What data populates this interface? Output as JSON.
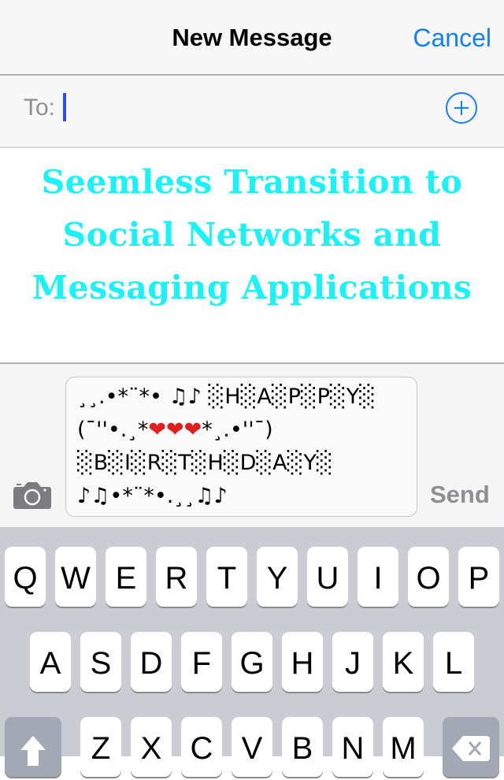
{
  "navbar": {
    "title": "New Message",
    "cancel_label": "Cancel",
    "accent_color": "#157efb"
  },
  "recipient": {
    "label": "To:",
    "value": "",
    "add_icon": "plus-circle-icon"
  },
  "promo": {
    "lines": [
      "Seemless Transition to",
      "Social Networks and",
      "Messaging Applications"
    ],
    "color": "#1af2f7"
  },
  "composer": {
    "camera_icon": "camera-icon",
    "message_lines": [
      "¸¸.•*¨*• ♫♪ ░H░A░P░P░Y░",
      "(¯''•.¸*❤❤❤*¸.•''¯)",
      "░B░I░R░T░H░D░A░Y░",
      "♪♫•*¨*•.¸¸♫♪"
    ],
    "send_label": "Send"
  },
  "keyboard": {
    "row1": [
      "Q",
      "W",
      "E",
      "R",
      "T",
      "Y",
      "U",
      "I",
      "O",
      "P"
    ],
    "row2": [
      "A",
      "S",
      "D",
      "F",
      "G",
      "H",
      "J",
      "K",
      "L"
    ],
    "row3": [
      "Z",
      "X",
      "C",
      "V",
      "B",
      "N",
      "M"
    ],
    "shift_icon": "shift-arrow-icon",
    "delete_icon": "backspace-icon"
  }
}
